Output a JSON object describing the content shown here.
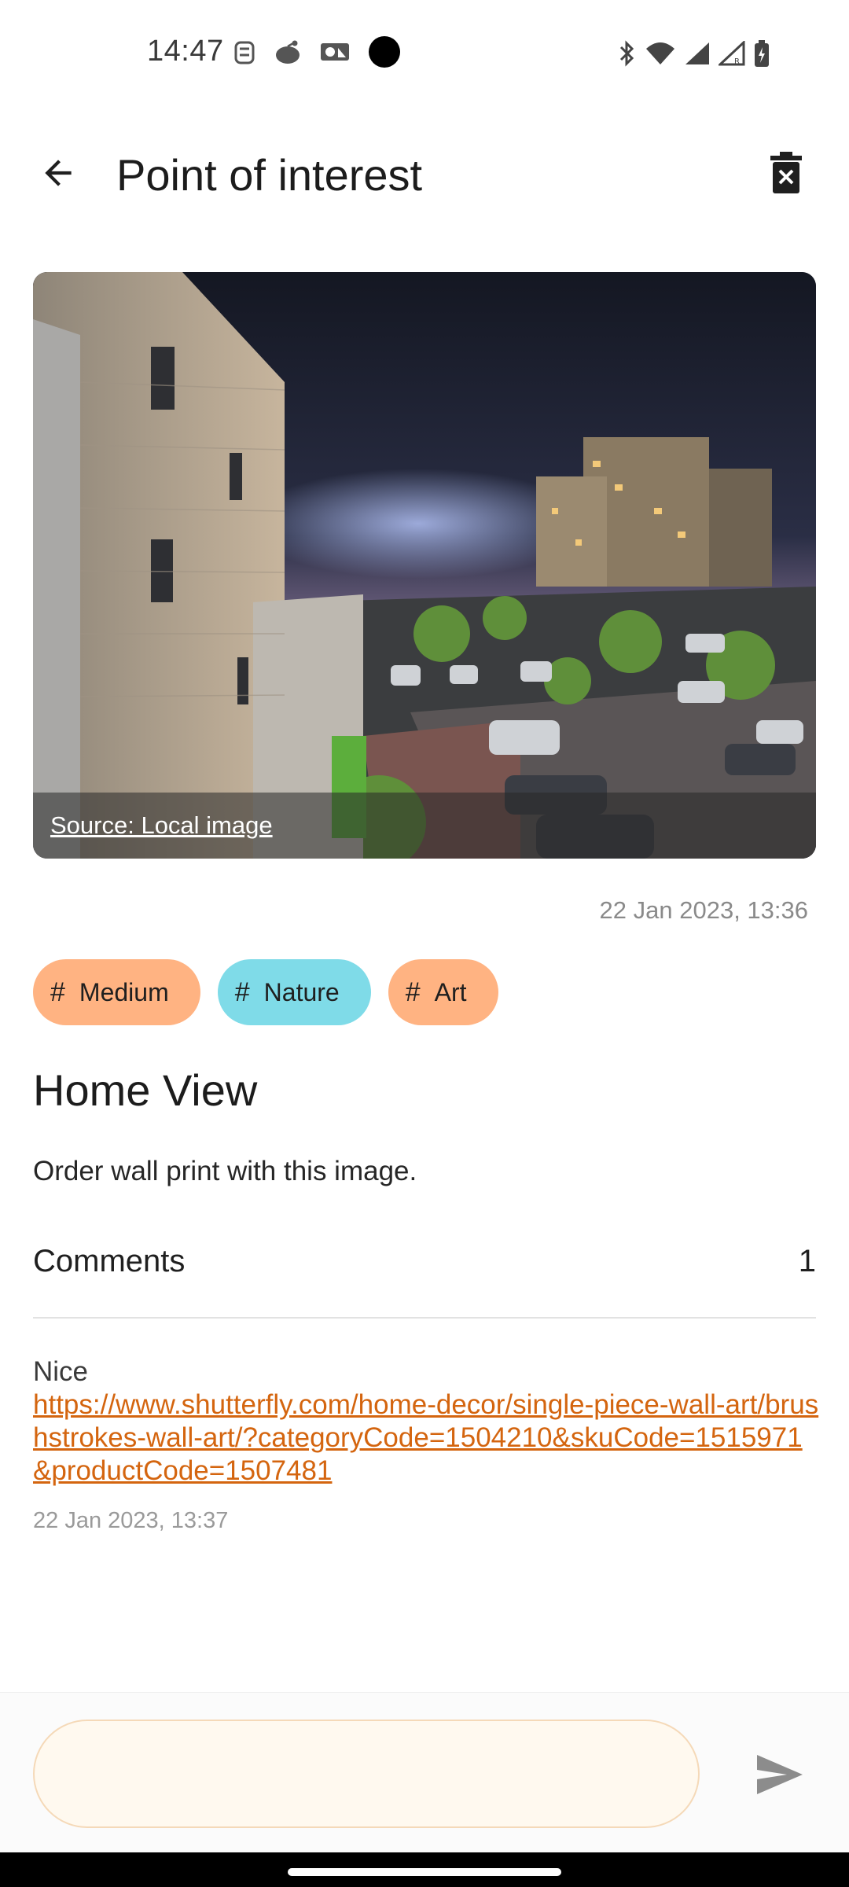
{
  "status_bar": {
    "time": "14:47",
    "left_icons": [
      "alarm-icon",
      "reddit-icon",
      "photos-icon",
      "camera-dot-icon"
    ],
    "right_icons": [
      "bluetooth-icon",
      "wifi-icon",
      "signal-icon",
      "signal-roaming-icon",
      "battery-charging-icon"
    ]
  },
  "app_bar": {
    "title": "Point of interest",
    "back_icon": "arrow-back-icon",
    "delete_icon": "delete-icon"
  },
  "photo": {
    "source_label": "Source: Local image"
  },
  "post": {
    "date": "22 Jan 2023, 13:36",
    "tags": [
      {
        "label": "Medium",
        "color": "#ffb382"
      },
      {
        "label": "Nature",
        "color": "#7fdbe8"
      },
      {
        "label": "Art",
        "color": "#ffb382"
      }
    ],
    "title": "Home View",
    "description": "Order wall print with this image."
  },
  "comments": {
    "header": "Comments",
    "count": "1",
    "items": [
      {
        "text": "Nice",
        "link": "https://www.shutterfly.com/home-decor/single-piece-wall-art/brushstrokes-wall-art/?categoryCode=1504210&skuCode=1515971&productCode=1507481",
        "date": "22 Jan 2023, 13:37"
      }
    ]
  },
  "composer": {
    "placeholder": "",
    "send_icon": "send-icon"
  },
  "colors": {
    "accent_link": "#d4650f",
    "input_background": "#fff9ef",
    "input_border": "#f5d9b8"
  }
}
